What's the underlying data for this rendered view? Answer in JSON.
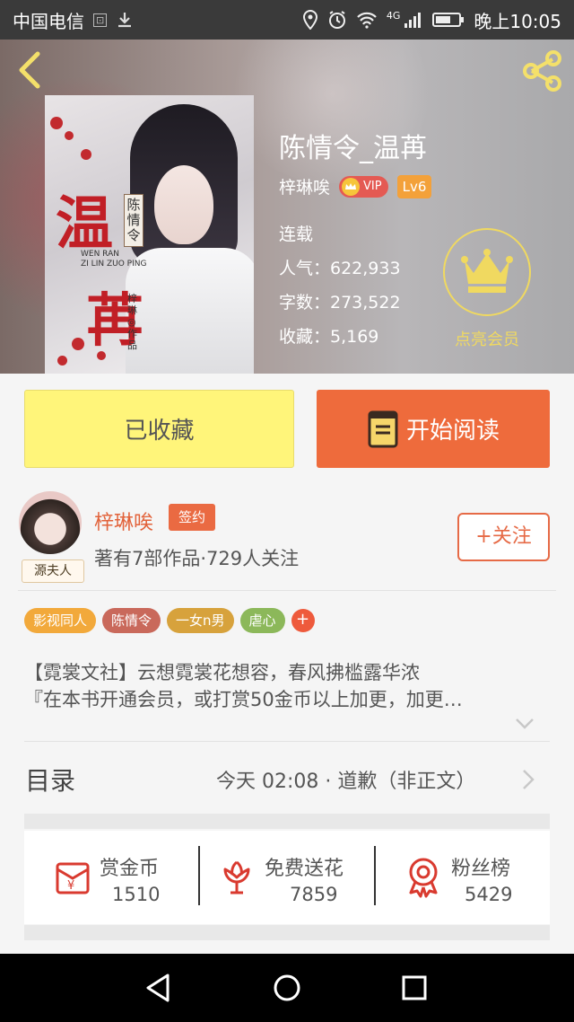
{
  "status_bar": {
    "carrier": "中国电信",
    "network_badge": "4G",
    "time": "晚上10:05",
    "icons": [
      "sim-icon",
      "download-icon",
      "location-icon",
      "alarm-icon",
      "wifi-icon",
      "signal-icon",
      "battery-icon"
    ]
  },
  "header": {
    "back_icon": "chevron-left-icon",
    "share_icon": "share-icon",
    "accent_color": "#f0d960"
  },
  "book": {
    "title": "陈情令_温苒",
    "author": "梓琳唉",
    "vip_label": "VIP",
    "level": "Lv6",
    "status": "连载",
    "popularity": "人气：622,933",
    "word_count": "字数：273,522",
    "favorites": "收藏：5,169",
    "vip_cta": "点亮会员",
    "cover": {
      "big_chars": [
        "温",
        "苒"
      ],
      "series": "陈情令",
      "pinyin": "WEN RAN\nZI LIN ZUO PING",
      "author_credit": "梓琳◎作品"
    }
  },
  "actions": {
    "favorited": "已收藏",
    "start_reading": "开始阅读",
    "favorited_color": "#fff57a",
    "read_color": "#ee6b3c"
  },
  "author_card": {
    "name": "梓琳唉",
    "sign_badge": "签约",
    "frame_tag": "源夫人",
    "summary": "著有7部作品·729人关注",
    "follow": "+关注"
  },
  "tags": [
    {
      "label": "影视同人",
      "color": "#f2a93b"
    },
    {
      "label": "陈情令",
      "color": "#c9695b"
    },
    {
      "label": "一女n男",
      "color": "#d7a23c"
    },
    {
      "label": "虐心",
      "color": "#8cb85a"
    }
  ],
  "tag_more": "+",
  "intro": {
    "line1": "【霓裳文社】云想霓裳花想容，春风拂槛露华浓",
    "line2": "『在本书开通会员，或打赏50金币以上加更，加更…"
  },
  "toc": {
    "label": "目录",
    "latest": "今天 02:08 · 道歉（非正文）"
  },
  "rewards": [
    {
      "label": "赏金币",
      "count": "1510",
      "icon": "red-envelope-icon"
    },
    {
      "label": "免费送花",
      "count": "7859",
      "icon": "flower-icon"
    },
    {
      "label": "粉丝榜",
      "count": "5429",
      "icon": "medal-icon"
    }
  ],
  "nav_bar": {
    "icons": [
      "back-triangle-icon",
      "home-circle-icon",
      "recents-square-icon"
    ]
  }
}
